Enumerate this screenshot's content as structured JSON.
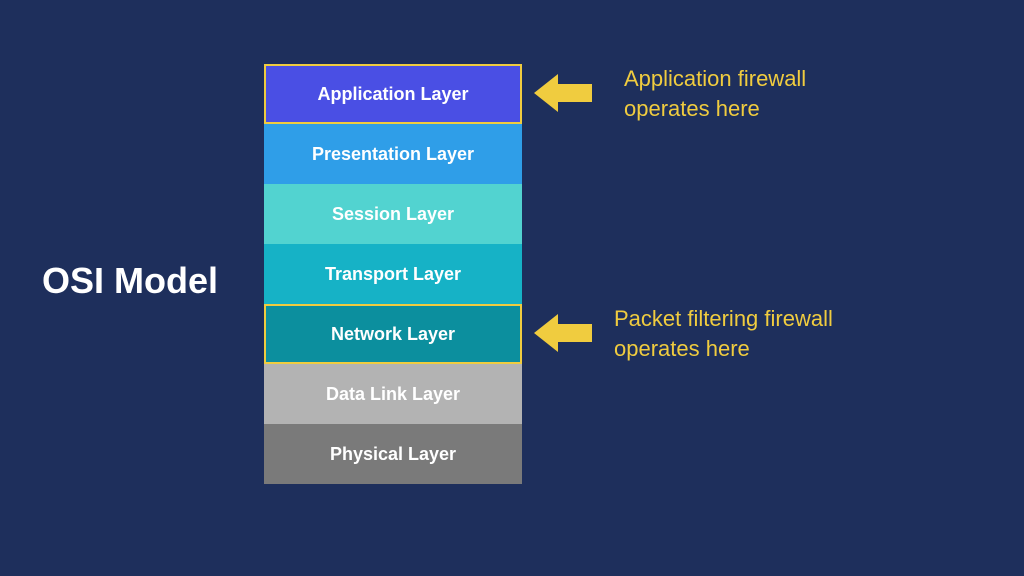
{
  "title": "OSI Model",
  "layers": [
    {
      "label": "Application Layer",
      "color": "#4a4fe4",
      "highlighted": true
    },
    {
      "label": "Presentation Layer",
      "color": "#2f9ee8",
      "highlighted": false
    },
    {
      "label": "Session Layer",
      "color": "#52d3d0",
      "highlighted": false
    },
    {
      "label": "Transport Layer",
      "color": "#16b2c6",
      "highlighted": false
    },
    {
      "label": "Network Layer",
      "color": "#0c8f9e",
      "highlighted": true
    },
    {
      "label": "Data Link Layer",
      "color": "#b3b3b3",
      "highlighted": false
    },
    {
      "label": "Physical Layer",
      "color": "#7a7a7a",
      "highlighted": false
    }
  ],
  "annotations": {
    "application": {
      "line1": "Application firewall",
      "line2": "operates here"
    },
    "network": {
      "line1": "Packet filtering firewall",
      "line2": "operates here"
    }
  },
  "colors": {
    "background": "#1e2f5c",
    "accent": "#f0cc3f",
    "text": "#ffffff"
  }
}
